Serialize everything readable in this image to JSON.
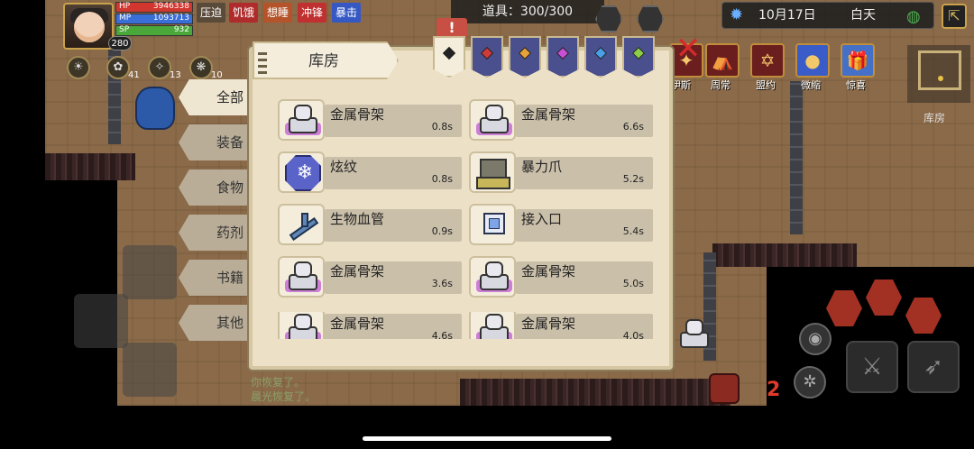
{
  "hud": {
    "level": "280",
    "hp_label": "HP",
    "hp_value": "3946338",
    "mp_label": "MP",
    "mp_value": "1093713",
    "sp_label": "SP",
    "sp_value": "932",
    "status_tags": [
      "压迫",
      "饥饿",
      "想睡",
      "冲锋",
      "暴击"
    ],
    "buffs": [
      {
        "icon": "☀",
        "count": ""
      },
      {
        "icon": "✿",
        "count": "41"
      },
      {
        "icon": "✧",
        "count": "13"
      },
      {
        "icon": "❋",
        "count": "10"
      }
    ]
  },
  "top": {
    "item_count": "道具：300/300",
    "date": "10月17日",
    "daytime": "白天"
  },
  "menu": {
    "items": [
      "伊斯",
      "周常",
      "盟约",
      "微缩",
      "惊喜"
    ]
  },
  "minimap": {
    "label": "库房"
  },
  "categories": [
    "全部",
    "装备",
    "食物",
    "药剂",
    "书籍",
    "其他"
  ],
  "panel": {
    "title": "库房",
    "filter_colors": [
      "#222222",
      "#d23a3a",
      "#e8a23a",
      "#c94fd6",
      "#4aa0e8",
      "#8ccd4a"
    ],
    "items": [
      {
        "name": "金属骨架",
        "time": "0.8s"
      },
      {
        "name": "金属骨架",
        "time": "6.6s"
      },
      {
        "name": "炫纹",
        "time": "0.8s"
      },
      {
        "name": "暴力爪",
        "time": "5.2s"
      },
      {
        "name": "生物血管",
        "time": "0.9s"
      },
      {
        "name": "接入口",
        "time": "5.4s"
      },
      {
        "name": "金属骨架",
        "time": "3.6s"
      },
      {
        "name": "金属骨架",
        "time": "5.0s"
      },
      {
        "name": "金属骨架",
        "time": "4.6s"
      },
      {
        "name": "金属骨架",
        "time": "4.0s"
      }
    ]
  },
  "chat": {
    "line1": "你恢复了。",
    "line2": "晨光恢复了。"
  },
  "potion_count": "2",
  "alert": "!"
}
